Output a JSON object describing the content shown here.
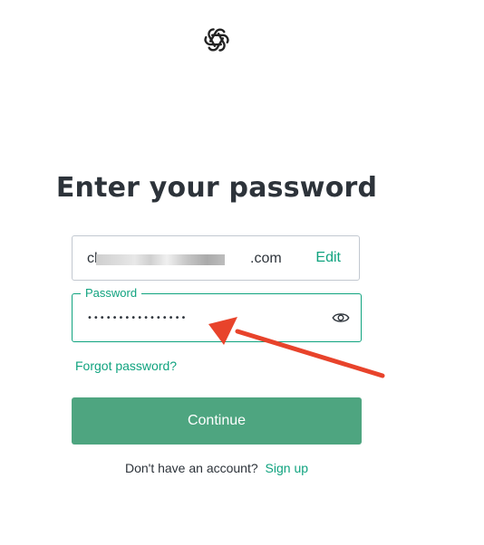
{
  "logo": {
    "icon": "openai-logo-icon"
  },
  "title": "Enter your password",
  "email": {
    "prefix": "ch",
    "suffix": ".com",
    "edit_label": "Edit"
  },
  "password": {
    "label": "Password",
    "value": "••••••••••••••••",
    "toggle_icon": "eye-icon"
  },
  "forgot_label": "Forgot password?",
  "continue_label": "Continue",
  "signup": {
    "text": "Don't have an account?",
    "link_label": "Sign up"
  },
  "colors": {
    "accent": "#10a37f",
    "button": "#4ea580",
    "annotation": "#e8432b"
  }
}
